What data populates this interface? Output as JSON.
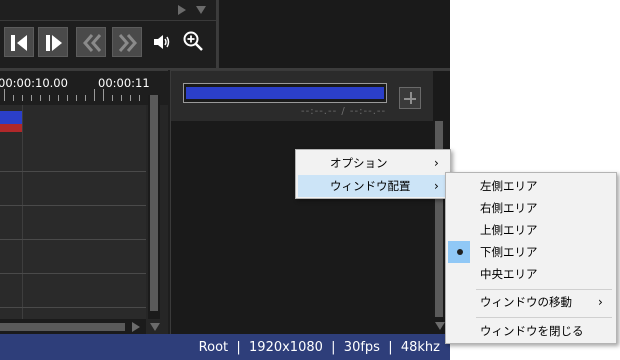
{
  "transport": {
    "buttons": [
      "step-back",
      "step-forward",
      "rewind",
      "fast-forward"
    ],
    "icons": [
      "volume-icon",
      "zoom-in-icon"
    ]
  },
  "timeline": {
    "time_labels": [
      "00:00:10.00",
      "00:00:11"
    ],
    "clip_colors": {
      "blue": "#2b3fc9",
      "red": "#b0282a"
    }
  },
  "right_panel": {
    "time_readout": "--:--.-- / --:--.--",
    "level_color": "#2b3fc9"
  },
  "status": {
    "text": "Root  |  1920x1080  |  30fps  |  48khz",
    "background": "#2e3e7a"
  },
  "menu_main": {
    "items": [
      {
        "label": "オプション",
        "has_submenu": true
      },
      {
        "label": "ウィンドウ配置",
        "has_submenu": true,
        "highlighted": true
      }
    ]
  },
  "menu_sub": {
    "items": [
      {
        "label": "左側エリア"
      },
      {
        "label": "右側エリア"
      },
      {
        "label": "上側エリア"
      },
      {
        "label": "下側エリア",
        "checked": true
      },
      {
        "label": "中央エリア"
      },
      {
        "label": "ウィンドウの移動",
        "has_submenu": true
      },
      {
        "label": "ウィンドウを閉じる"
      }
    ]
  },
  "colors": {
    "menu_highlight": "#cce4f7",
    "checked_highlight": "#90c8f6"
  }
}
